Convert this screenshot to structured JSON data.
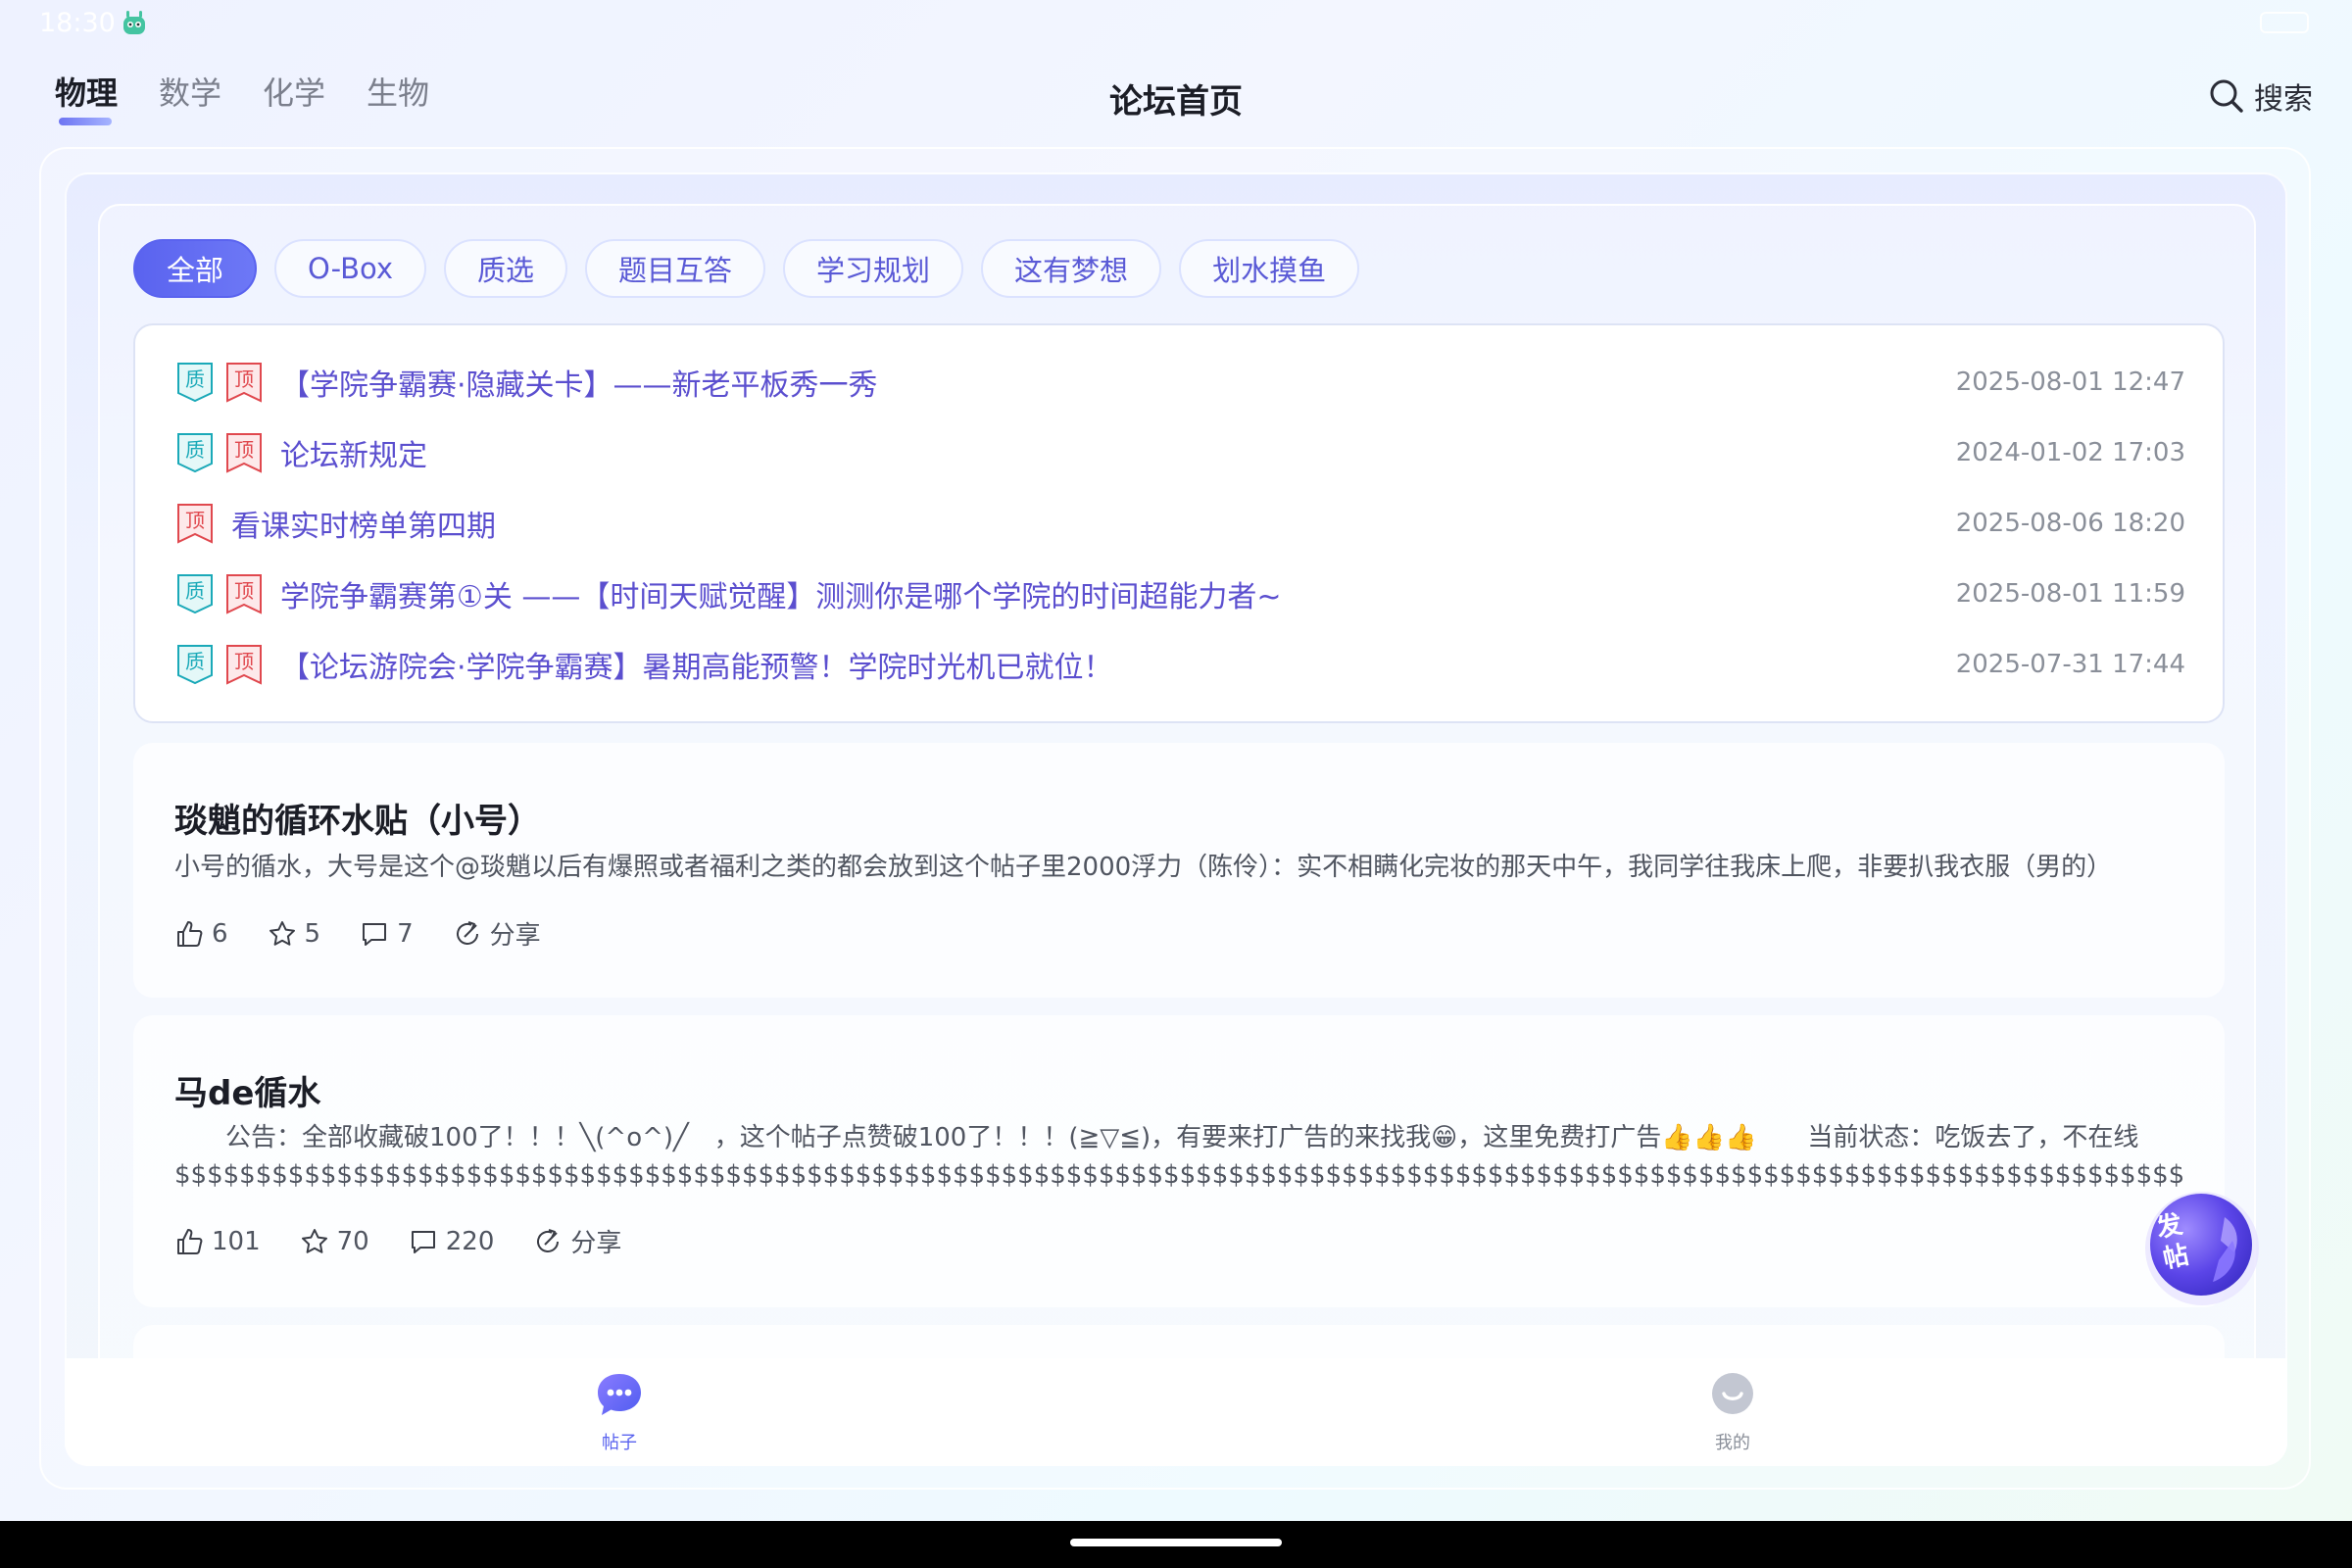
{
  "status_bar": {
    "time": "18:30",
    "robot_icon": "robot-icon",
    "battery_icon": "battery-icon"
  },
  "header": {
    "subject_tabs": [
      {
        "label": "物理",
        "active": true
      },
      {
        "label": "数学",
        "active": false
      },
      {
        "label": "化学",
        "active": false
      },
      {
        "label": "生物",
        "active": false
      }
    ],
    "title": "论坛首页",
    "search_label": "搜索",
    "search_icon": "search-icon"
  },
  "categories": [
    {
      "label": "全部",
      "active": true
    },
    {
      "label": "O-Box",
      "active": false
    },
    {
      "label": "质选",
      "active": false
    },
    {
      "label": "题目互答",
      "active": false
    },
    {
      "label": "学习规划",
      "active": false
    },
    {
      "label": "这有梦想",
      "active": false
    },
    {
      "label": "划水摸鱼",
      "active": false
    }
  ],
  "badges": {
    "quality": "质",
    "top": "顶"
  },
  "pinned_posts": [
    {
      "title": "【学院争霸赛·隐藏关卡】——新老平板秀一秀",
      "date": "2025-08-01 12:47",
      "quality": true,
      "top": true
    },
    {
      "title": "论坛新规定",
      "date": "2024-01-02 17:03",
      "quality": true,
      "top": true
    },
    {
      "title": "看课实时榜单第四期",
      "date": "2025-08-06 18:20",
      "quality": false,
      "top": true
    },
    {
      "title": "学院争霸赛第①关 ——【时间天赋觉醒】测测你是哪个学院的时间超能力者~",
      "date": "2025-08-01 11:59",
      "quality": true,
      "top": true
    },
    {
      "title": "【论坛游院会·学院争霸赛】暑期高能预警！学院时光机已就位！",
      "date": "2025-07-31 17:44",
      "quality": true,
      "top": true
    }
  ],
  "posts": [
    {
      "title": "琰魈的循环水贴（小号）",
      "body": "小号的循水，大号是这个@琰魈以后有爆照或者福利之类的都会放到这个帖子里2000浮力（陈伶）：实不相瞒化完妆的那天中午，我同学往我床上爬，非要扒我衣服（男的）",
      "likes": "6",
      "favorites": "5",
      "comments": "7",
      "share_label": "分享"
    },
    {
      "title": "马de循水",
      "body": "　　公告：全部收藏破100了！！！╲(^o^)╱　，这个帖子点赞破100了！！！(≧▽≦)，有要来打广告的来找我😁，这里免费打广告👍👍👍　　当前状态：吃饭去了，不在线 $$$$$$$$$$$$$$$$$$$$$$$$$$$$$$$$$$$$$$$$$$$$$$$$$$$$$$$$$$$$$$$$$$$$$$$$$$$$$$$$$$$$$$$$$$$$$$$$$$$$$$$$$$$$$$$$$$$$$$$$$$$$$$$$$$$$$$$$$$$$$$$$$$$$$$$$$$$$$$$$$$$$$$$$$$$$$$$$$$$$$$$$$$$$$$$$$$$$$$$$$$$",
      "likes": "101",
      "favorites": "70",
      "comments": "220",
      "share_label": "分享"
    }
  ],
  "fab_label": "发帖",
  "bottom_nav": [
    {
      "label": "帖子",
      "icon": "chat-bubble-icon",
      "active": true
    },
    {
      "label": "我的",
      "icon": "profile-icon",
      "active": false
    }
  ],
  "colors": {
    "accent": "#5a63ef",
    "pinned_title": "#5b4fcf",
    "quality_badge": "#1aa9b8",
    "top_badge": "#e0484e"
  }
}
